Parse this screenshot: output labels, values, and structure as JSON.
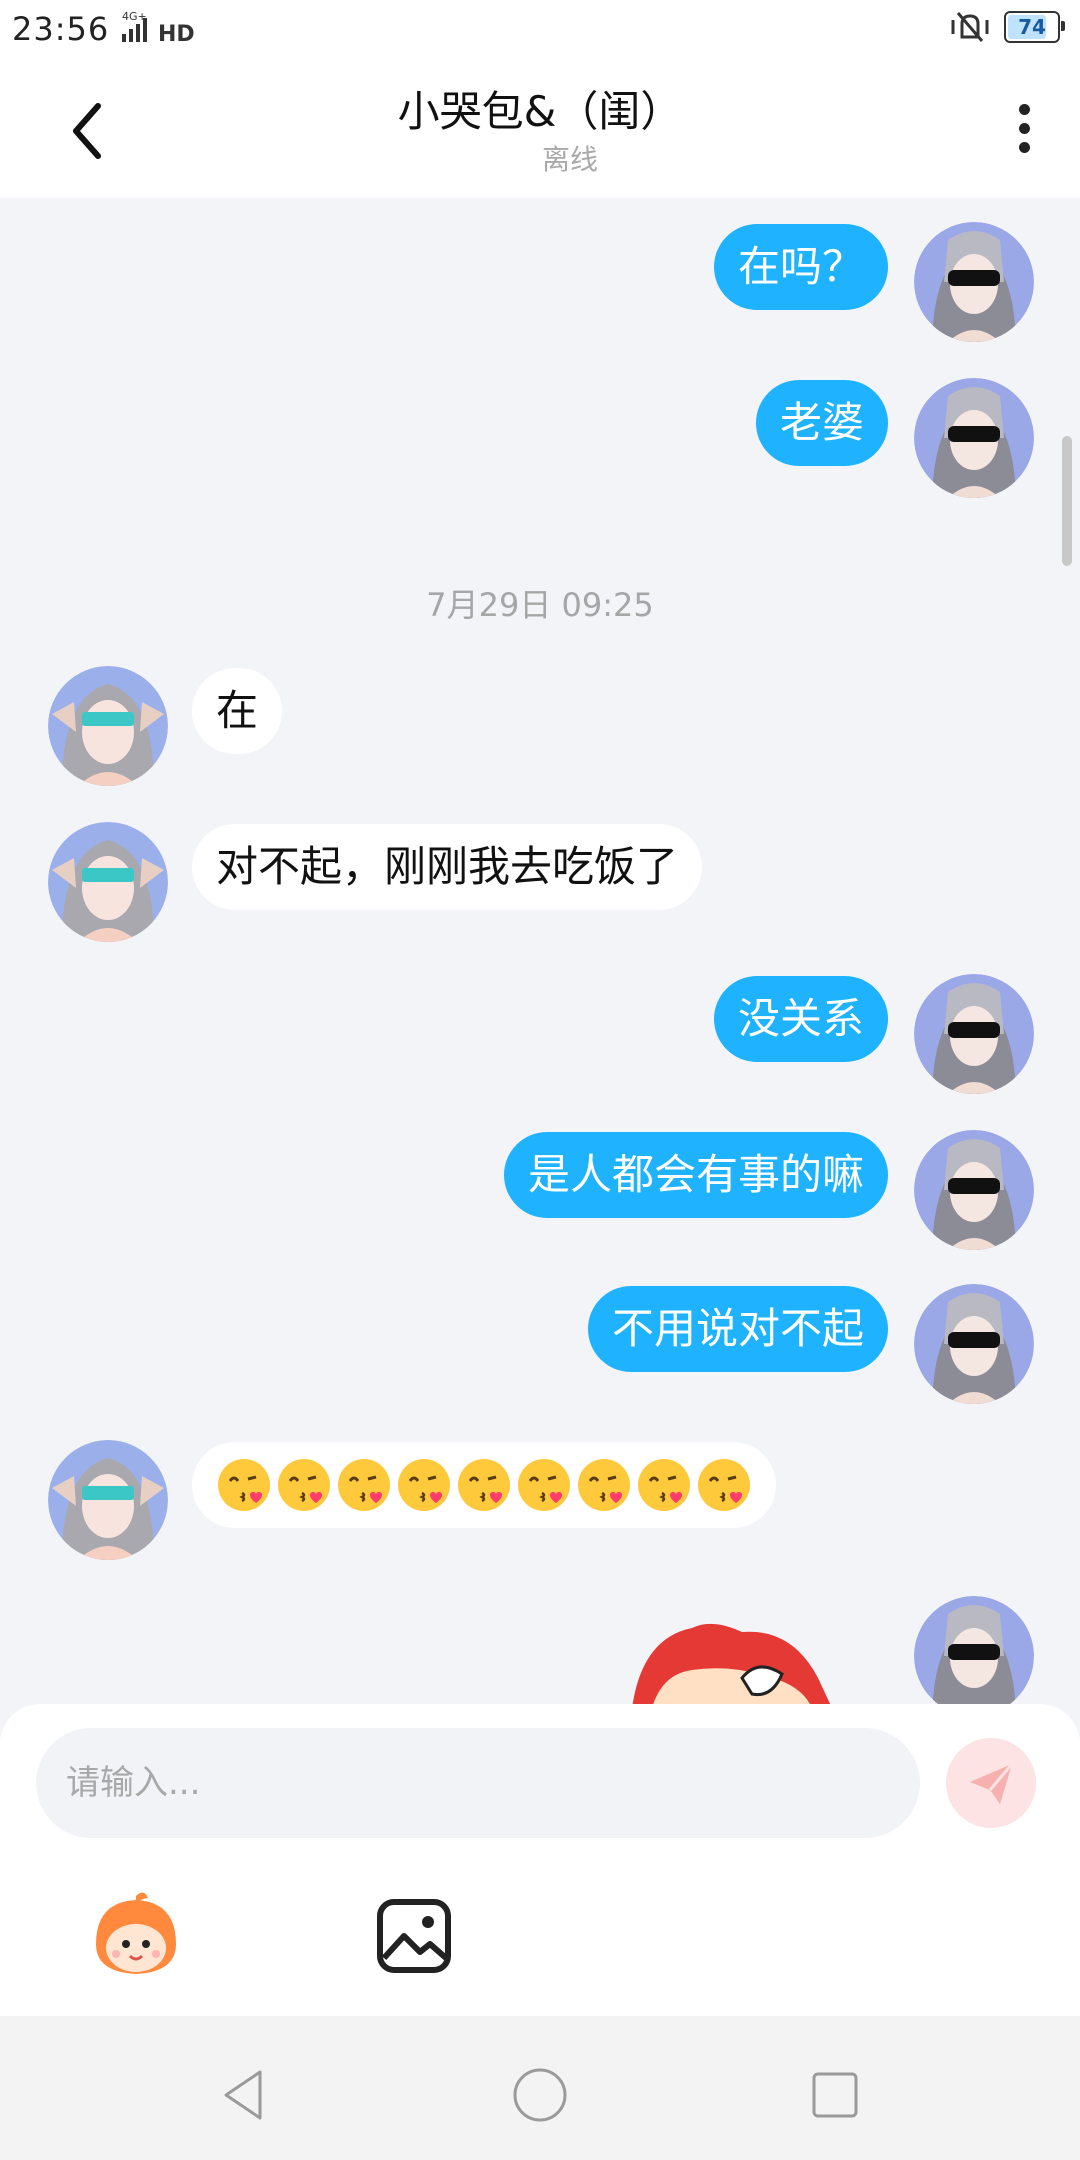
{
  "status_bar": {
    "time": "23:56",
    "network": "4G+ HD",
    "battery": "74"
  },
  "header": {
    "title": "小哭包&（闺）",
    "subtitle": "离线"
  },
  "chat": {
    "messages": [
      {
        "side": "right",
        "text": "在吗？"
      },
      {
        "side": "right",
        "text": "老婆"
      },
      {
        "side": "left",
        "text": "在"
      },
      {
        "side": "left",
        "text": "对不起，刚刚我去吃饭了"
      },
      {
        "side": "right",
        "text": "没关系"
      },
      {
        "side": "right",
        "text": "是人都会有事的嘛"
      },
      {
        "side": "right",
        "text": "不用说对不起"
      },
      {
        "side": "left",
        "emoji": "kissing-face-with-heart",
        "count": 9
      }
    ],
    "time_divider": "7月29日 09:25"
  },
  "input": {
    "placeholder": "请输入..."
  },
  "icons": {
    "back": "chevron-left-icon",
    "more": "more-vertical-icon",
    "send": "send-icon",
    "sticker": "monkey-sticker-icon",
    "image": "image-icon",
    "nav": [
      "back-triangle-icon",
      "home-circle-icon",
      "recent-square-icon"
    ]
  },
  "colors": {
    "sent_bubble": "#1eb2ff",
    "received_bubble": "#ffffff",
    "background": "#f3f4f8",
    "send_button": "#fde4e4"
  }
}
